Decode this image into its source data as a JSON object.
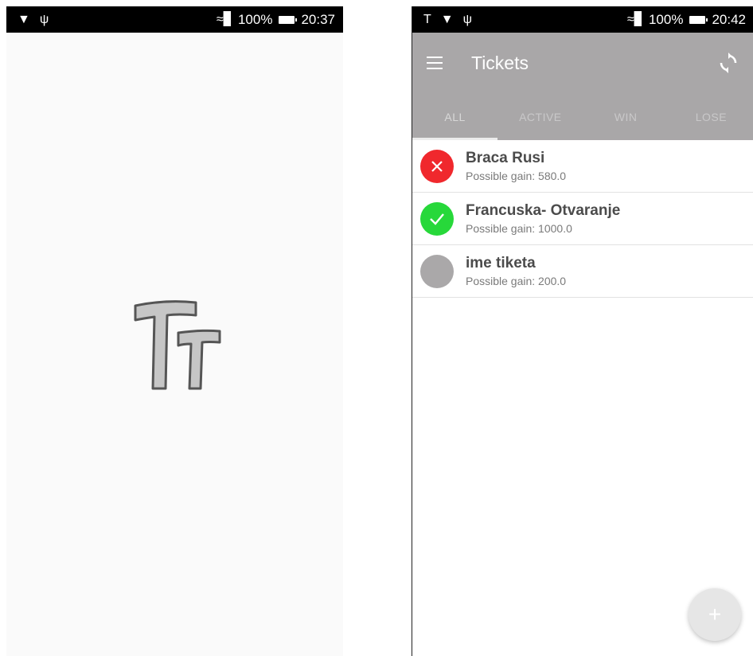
{
  "splash_screen": {
    "status_bar": {
      "battery": "100%",
      "time": "20:37"
    },
    "logo_text": "Tt"
  },
  "tickets_screen": {
    "status_bar": {
      "battery": "100%",
      "time": "20:42"
    },
    "app_bar": {
      "title": "Tickets",
      "menu_icon": "hamburger-menu-icon",
      "sync_icon": "sync-icon"
    },
    "tabs": [
      {
        "label": "ALL",
        "active": true
      },
      {
        "label": "ACTIVE",
        "active": false
      },
      {
        "label": "WIN",
        "active": false
      },
      {
        "label": "LOSE",
        "active": false
      }
    ],
    "tickets": [
      {
        "name": "Braca Rusi",
        "gain": "Possible gain: 580.0",
        "status": "lose",
        "color": "#f0282d",
        "icon": "close-icon"
      },
      {
        "name": "Francuska- Otvaranje",
        "gain": "Possible gain: 1000.0",
        "status": "win",
        "color": "#27d83a",
        "icon": "check-icon"
      },
      {
        "name": "ime tiketa",
        "gain": "Possible gain: 200.0",
        "status": "active",
        "color": "#aaa8a9",
        "icon": "none"
      }
    ],
    "fab": {
      "label": "+",
      "icon": "plus-icon"
    }
  },
  "colors": {
    "app_bar": "#a9a7a8",
    "lose": "#f0282d",
    "win": "#27d83a",
    "pending": "#aaa8a9"
  }
}
